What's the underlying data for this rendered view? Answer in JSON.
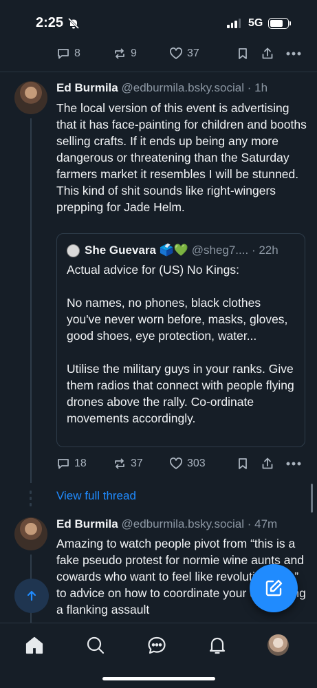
{
  "status_bar": {
    "time": "2:25",
    "network": "5G"
  },
  "top_actions": {
    "replies": "8",
    "reposts": "9",
    "likes": "37"
  },
  "post1": {
    "author": "Ed Burmila",
    "handle": "@edburmila.bsky.social",
    "time": "· 1h",
    "text": "The local version of this event is advertising that it has face-painting for children and booths selling crafts. If it ends up being any more dangerous or threatening than the Saturday farmers market it resembles I will be stunned. This kind of shit sounds like right-wingers prepping for Jade Helm.",
    "quote": {
      "author": "She Guevara 🗳️💚",
      "handle": "@sheg7....",
      "time": "· 22h",
      "line1": "Actual advice for (US) No Kings:",
      "line2": "No names, no phones, black clothes you've never worn before, masks, gloves, good shoes, eye protection, water...",
      "line3": "Utilise the military guys in your ranks. Give them radios that connect with people flying drones above the rally. Co-ordinate movements accordingly."
    },
    "actions": {
      "replies": "18",
      "reposts": "37",
      "likes": "303"
    }
  },
  "view_thread": "View full thread",
  "post2": {
    "author": "Ed Burmila",
    "handle": "@edburmila.bsky.social",
    "time": "· 47m",
    "text": "Amazing to watch people pivot from “this is a fake pseudo protest for normie wine aunts and cowards who want to feel like revolutionaries” to advice on how to coordinate your unit during a flanking assault"
  },
  "icons": {
    "reply": "speech-bubble-icon",
    "repost": "repost-arrows-icon",
    "like": "heart-icon",
    "bookmark": "bookmark-icon",
    "share": "share-icon",
    "more": "ellipsis-icon",
    "compose": "compose-pencil-icon",
    "scroll_top": "arrow-up-icon",
    "tabs": [
      "home-icon",
      "search-icon",
      "chat-icon",
      "bell-icon",
      "profile-avatar"
    ]
  },
  "colors": {
    "background": "#161e27",
    "accent": "#208bfe",
    "muted": "#8c97a3"
  }
}
